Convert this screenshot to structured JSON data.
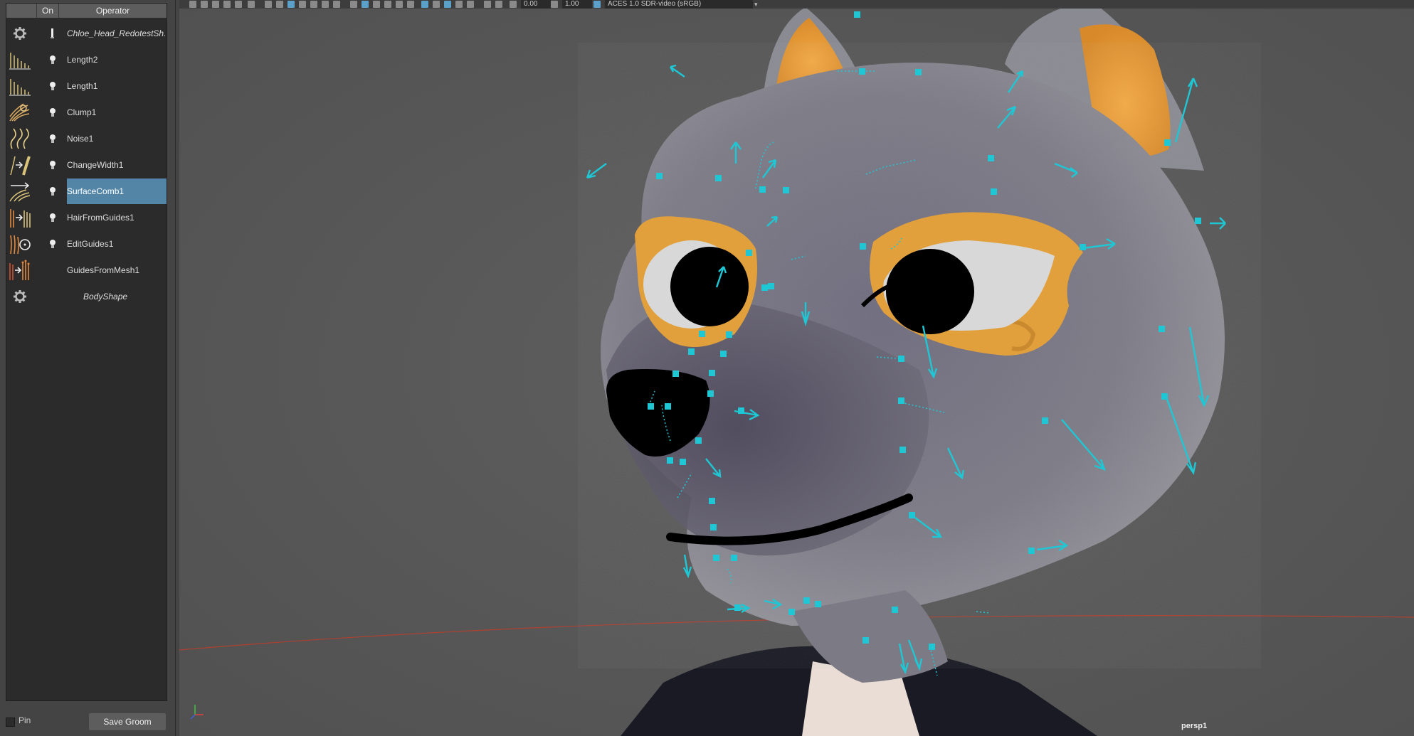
{
  "operator_panel": {
    "columns": {
      "blank": "",
      "on": "On",
      "operator": "Operator"
    },
    "operators": [
      {
        "name": "Chloe_Head_RedotestSh...",
        "icon": "gear-icon",
        "toggle": "on-toggle-icon",
        "selected": false,
        "italic": true
      },
      {
        "name": "Length2",
        "icon": "length-icon",
        "toggle": "bulb-icon",
        "selected": false,
        "italic": false
      },
      {
        "name": "Length1",
        "icon": "length-icon",
        "toggle": "bulb-icon",
        "selected": false,
        "italic": false
      },
      {
        "name": "Clump1",
        "icon": "clump-icon",
        "toggle": "bulb-icon",
        "selected": false,
        "italic": false
      },
      {
        "name": "Noise1",
        "icon": "noise-icon",
        "toggle": "bulb-icon",
        "selected": false,
        "italic": false
      },
      {
        "name": "ChangeWidth1",
        "icon": "change-width-icon",
        "toggle": "bulb-icon",
        "selected": false,
        "italic": false
      },
      {
        "name": "SurfaceComb1",
        "icon": "surface-comb-icon",
        "toggle": "bulb-icon",
        "selected": true,
        "italic": false
      },
      {
        "name": "HairFromGuides1",
        "icon": "hair-from-guides-icon",
        "toggle": "bulb-icon",
        "selected": false,
        "italic": false
      },
      {
        "name": "EditGuides1",
        "icon": "edit-guides-icon",
        "toggle": "bulb-icon",
        "selected": false,
        "italic": false
      },
      {
        "name": "GuidesFromMesh1",
        "icon": "guides-from-mesh-icon",
        "toggle": "",
        "selected": false,
        "italic": false
      },
      {
        "name": "BodyShape",
        "icon": "gear-icon",
        "toggle": "",
        "selected": false,
        "italic": true
      }
    ],
    "pin_label": "Pin",
    "save_button": "Save Groom"
  },
  "viewport": {
    "toolbar": {
      "field_1": "0.00",
      "field_2": "1.00",
      "color_space": "ACES 1.0 SDR-video (sRGB)"
    },
    "camera_label": "persp1"
  },
  "colors": {
    "panel_bg": "#444444",
    "list_bg": "#2b2b2b",
    "selected_row": "#5285a6",
    "viewport_bg": "#575757",
    "guide_color": "#1fc7d4",
    "fur_gray": "#8a8a90",
    "eye_ring": "#e7a43a",
    "ear_inner": "#f0a23a"
  }
}
